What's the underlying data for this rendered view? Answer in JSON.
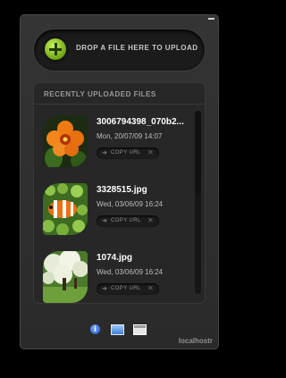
{
  "upload": {
    "drop_label": "DROP A FILE HERE TO UPLOAD",
    "add_icon": "green-plus-icon"
  },
  "recent": {
    "title": "RECENTLY UPLOADED FILES",
    "copy_label": "COPY URL",
    "copy_arrow": "➔",
    "delete_glyph": "✕",
    "items": [
      {
        "name": "3006794398_070b2...",
        "date": "Mon, 20/07/09 14:07",
        "thumb": "orange-flower-photo"
      },
      {
        "name": "3328515.jpg",
        "date": "Wed, 03/06/09 16:24",
        "thumb": "clownfish-anemone-photo"
      },
      {
        "name": "1074.jpg",
        "date": "Wed, 03/06/09 16:24",
        "thumb": "flowering-tree-photo"
      }
    ]
  },
  "footer": {
    "info_glyph": "i",
    "icons": [
      "info-icon",
      "image-icon",
      "window-icon"
    ],
    "brand": "localhostr"
  },
  "colors": {
    "background": "#000000",
    "panel": "#2f2f2f",
    "accent_green": "#7ab51d",
    "info_blue": "#2e6fe0"
  }
}
